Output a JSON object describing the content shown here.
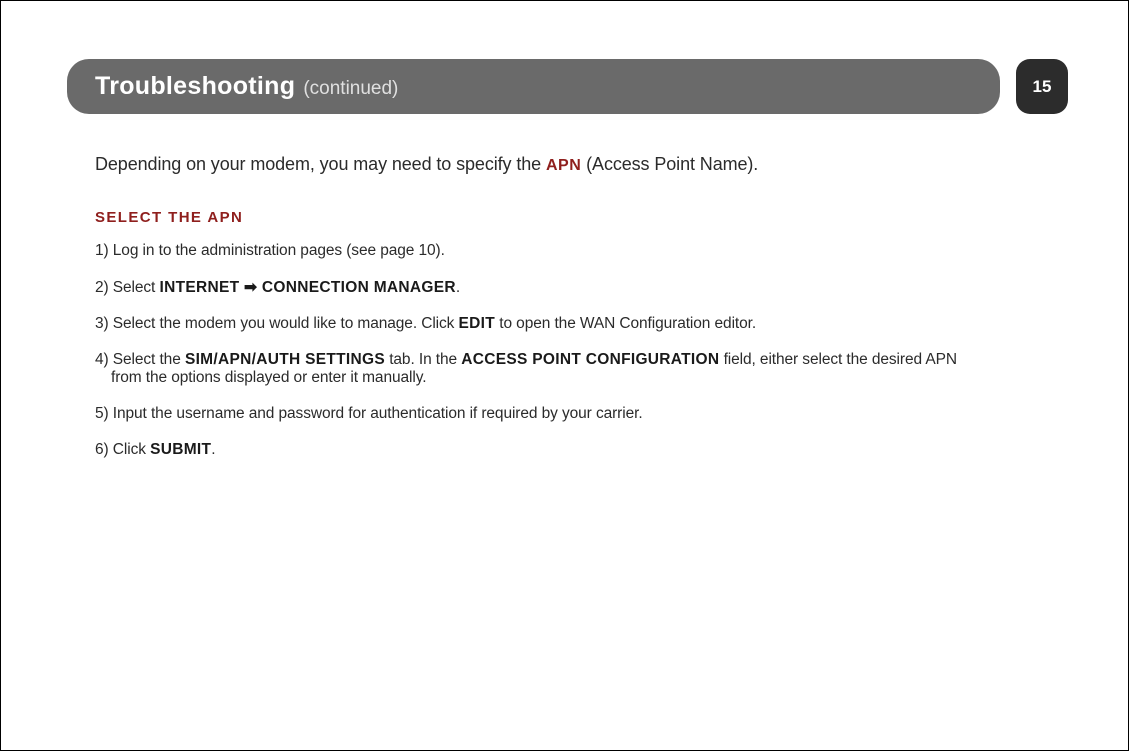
{
  "header": {
    "title": "Troubleshooting",
    "continued": "(continued)"
  },
  "page_number": "15",
  "intro": {
    "pre": "Depending on your modem, you may need to specify the ",
    "apn": "APN",
    "post": " (Access Point Name)."
  },
  "section_heading": "SELECT THE APN",
  "steps": {
    "s1": "1) Log in to the administration pages (see page 10).",
    "s2_pre": "2) Select ",
    "s2_b1": "INTERNET",
    "s2_arrow": " ➡ ",
    "s2_b2": "CONNECTION MANAGER",
    "s2_post": ".",
    "s3_pre": "3) Select the modem you would like to manage. Click ",
    "s3_b": "EDIT",
    "s3_post": " to open the WAN Configuration editor.",
    "s4_pre": "4) Select the ",
    "s4_b1": "SIM/APN/AUTH SETTINGS",
    "s4_mid": " tab. In the ",
    "s4_b2": "ACCESS POINT CONFIGURATION",
    "s4_post1": " field, either select the desired APN",
    "s4_post2": "from the options displayed or enter it manually.",
    "s5": "5) Input the username and password for authentication if required by your carrier.",
    "s6_pre": "6) Click ",
    "s6_b": "SUBMIT",
    "s6_post": "."
  }
}
